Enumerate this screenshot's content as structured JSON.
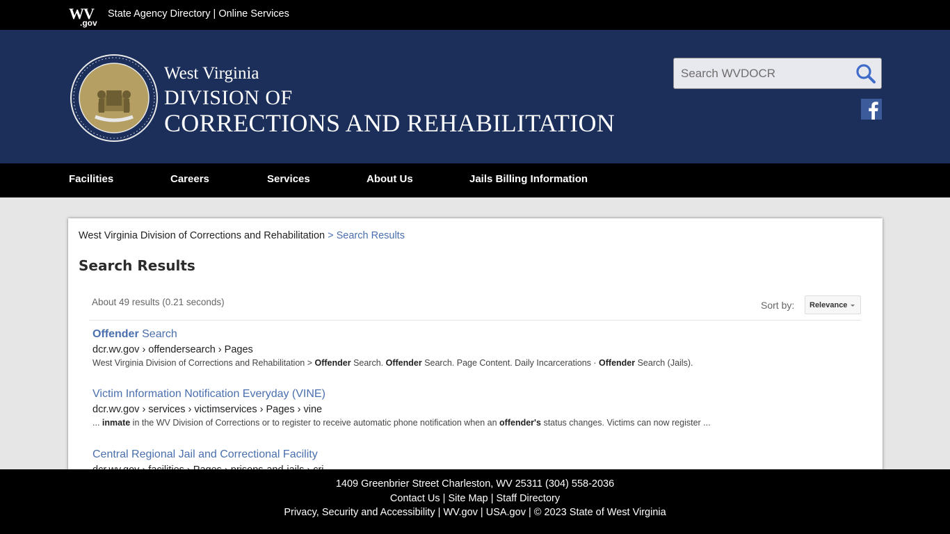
{
  "topbar": {
    "logo_wv": "WV",
    "logo_gov": ".gov",
    "link_directory": "State Agency Directory",
    "separator": "|",
    "link_services": "Online Services"
  },
  "header": {
    "title_line1": "West Virginia",
    "title_line2": "DIVISION OF",
    "title_line3": "CORRECTIONS AND REHABILITATION",
    "search_placeholder": "Search WVDOCR",
    "facebook_label": "f"
  },
  "nav": {
    "items": [
      {
        "label": "Facilities"
      },
      {
        "label": "Careers"
      },
      {
        "label": "Services"
      },
      {
        "label": "About Us"
      },
      {
        "label": "Jails Billing Information"
      }
    ]
  },
  "content": {
    "breadcrumb_home": "West Virginia Division of Corrections and Rehabilitation",
    "breadcrumb_sep": ">",
    "breadcrumb_current": "Search Results",
    "page_title": "Search Results",
    "result_count": "About 49 results (0.21 seconds)",
    "sort_label": "Sort by:",
    "sort_value": "Relevance",
    "results": [
      {
        "title_bold": "Offender",
        "title_rest": " Search",
        "url": "dcr.wv.gov › offendersearch › Pages",
        "snippet": [
          {
            "t": "West Virginia Division of Corrections and Rehabilitation > ",
            "b": false
          },
          {
            "t": "Offender",
            "b": true
          },
          {
            "t": " Search. ",
            "b": false
          },
          {
            "t": "Offender",
            "b": true
          },
          {
            "t": " Search. Page Content. Daily Incarcerations · ",
            "b": false
          },
          {
            "t": "Offender",
            "b": true
          },
          {
            "t": " Search (Jails).",
            "b": false
          }
        ]
      },
      {
        "title_bold": "",
        "title_rest": "Victim Information Notification Everyday (VINE)",
        "url": "dcr.wv.gov › services › victimservices › Pages › vine",
        "snippet": [
          {
            "t": "... ",
            "b": false
          },
          {
            "t": "inmate",
            "b": true
          },
          {
            "t": " in the WV Division of Corrections or to register to receive automatic phone notification when an ",
            "b": false
          },
          {
            "t": "offender's",
            "b": true
          },
          {
            "t": " status changes. Victims can now register ...",
            "b": false
          }
        ]
      },
      {
        "title_bold": "",
        "title_rest": "Central Regional Jail and Correctional Facility",
        "url": "dcr.wv.gov › facilities › Pages › prisons-and-jails › crj",
        "snippet": []
      }
    ]
  },
  "footer": {
    "address": "1409 Greenbrier Street Charleston, WV 25311 (304) 558-2036",
    "contact": "Contact Us",
    "sitemap": "Site Map",
    "staff": "Staff Directory",
    "privacy": "Privacy, Security and Accessibility",
    "wvgov": "WV.gov",
    "usagov": "USA.gov",
    "copyright": "© 2023 State of West Virginia",
    "sep": "|"
  },
  "colors": {
    "header_bg": "#1c2f5a",
    "link": "#4a6fae",
    "seal_gold": "#b59f63"
  }
}
